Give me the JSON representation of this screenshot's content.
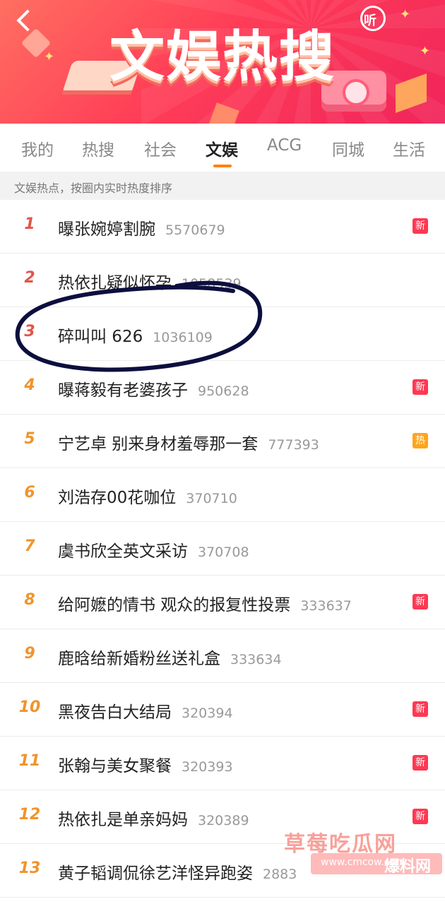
{
  "banner": {
    "title": "文娱热搜",
    "listen_label": "听"
  },
  "tabs": [
    {
      "label": "我的"
    },
    {
      "label": "热搜"
    },
    {
      "label": "社会"
    },
    {
      "label": "文娱"
    },
    {
      "label": "ACG"
    },
    {
      "label": "同城"
    },
    {
      "label": "生活"
    }
  ],
  "active_tab": "文娱",
  "subheader": "文娱热点，按圈内实时热度排序",
  "items": [
    {
      "rank": "1",
      "topic": "曝张婉婷割腕",
      "count": "5570679",
      "badge": "新"
    },
    {
      "rank": "2",
      "topic": "热依扎疑似怀孕",
      "count": "1058539",
      "badge": ""
    },
    {
      "rank": "3",
      "topic": "碎叫叫 626",
      "count": "1036109",
      "badge": ""
    },
    {
      "rank": "4",
      "topic": "曝蒋毅有老婆孩子",
      "count": "950628",
      "badge": "新"
    },
    {
      "rank": "5",
      "topic": "宁艺卓 别来身材羞辱那一套",
      "count": "777393",
      "badge": "热"
    },
    {
      "rank": "6",
      "topic": "刘浩存00花咖位",
      "count": "370710",
      "badge": ""
    },
    {
      "rank": "7",
      "topic": "虞书欣全英文采访",
      "count": "370708",
      "badge": ""
    },
    {
      "rank": "8",
      "topic": "给阿嬷的情书 观众的报复性投票",
      "count": "333637",
      "badge": "新"
    },
    {
      "rank": "9",
      "topic": "鹿晗给新婚粉丝送礼盒",
      "count": "333634",
      "badge": ""
    },
    {
      "rank": "10",
      "topic": "黑夜告白大结局",
      "count": "320394",
      "badge": "新"
    },
    {
      "rank": "11",
      "topic": "张翰与美女聚餐",
      "count": "320393",
      "badge": "新"
    },
    {
      "rank": "12",
      "topic": "热依扎是单亲妈妈",
      "count": "320389",
      "badge": "新"
    },
    {
      "rank": "13",
      "topic": "黄子韬调侃徐艺洋怪异跑姿",
      "count": "2883",
      "badge": ""
    }
  ],
  "colors": {
    "accent": "#ff8200",
    "rank_top": "#e4544a",
    "rank_mid": "#f0942c",
    "badge_new": "#ff3852",
    "badge_hot": "#ffa51a",
    "annotation": "#0c0f3e"
  },
  "watermark": {
    "line1": "草莓吃瓜网",
    "url": "www.cmcow.com",
    "line2": "爆料网"
  }
}
